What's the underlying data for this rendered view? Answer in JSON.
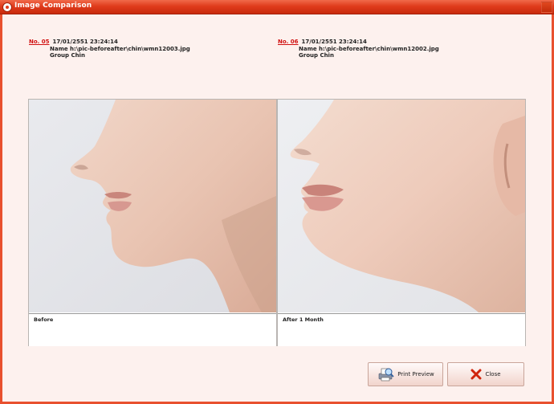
{
  "window": {
    "title": "Image Comparison"
  },
  "left": {
    "number": "No. 05",
    "datetime": "17/01/2551 23:24:14",
    "name_line": "Name h:\\pic-beforeafter\\chin\\wmn12003.jpg",
    "group_line": "Group Chin",
    "caption": "Before"
  },
  "right": {
    "number": "No. 06",
    "datetime": "17/01/2551 23:24:14",
    "name_line": "Name h:\\pic-beforeafter\\chin\\wmn12002.jpg",
    "group_line": "Group Chin",
    "caption": "After 1 Month"
  },
  "buttons": {
    "print_preview": "Print Preview",
    "close": "Close"
  },
  "icons": {
    "app": "app-icon",
    "print_preview": "print-preview-icon",
    "close": "close-x-icon"
  },
  "colors": {
    "titlebar": "#e03c1c",
    "background": "#fdf1ee",
    "number_link": "#d01010"
  }
}
